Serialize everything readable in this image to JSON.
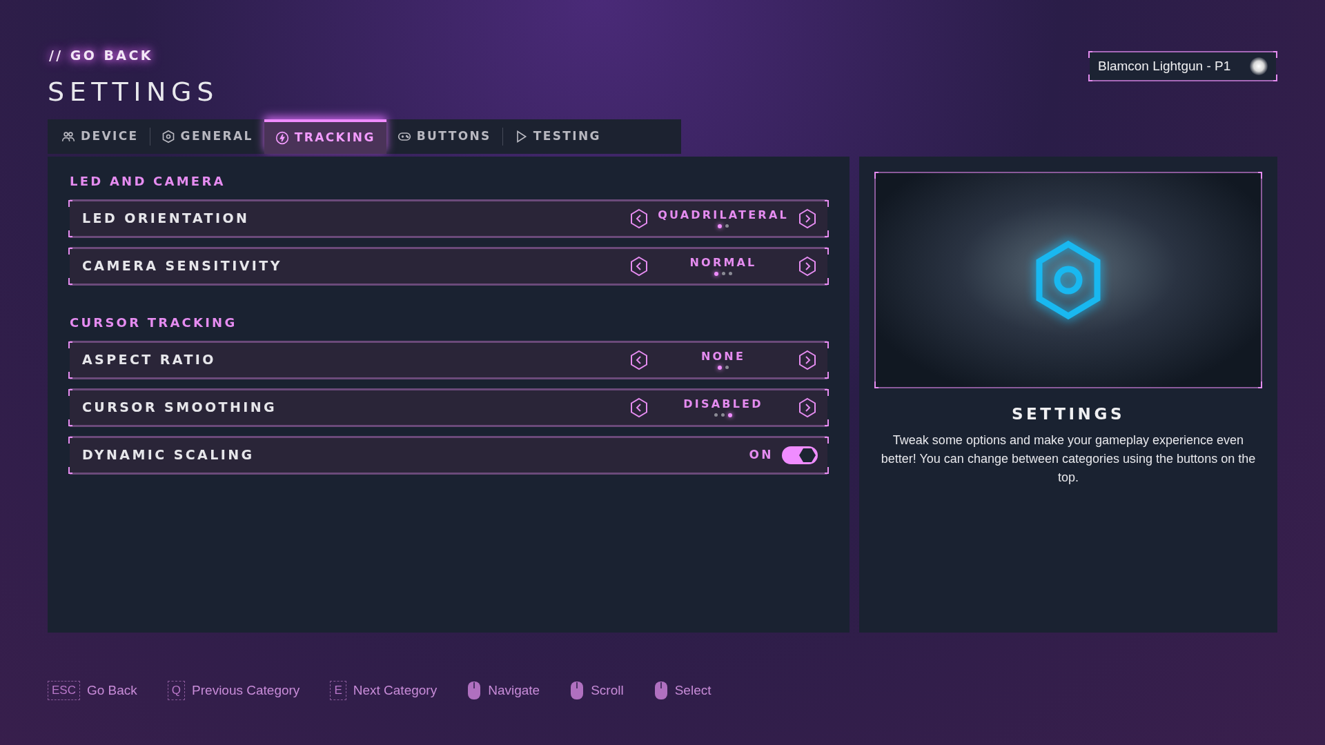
{
  "header": {
    "back_link": "// GO BACK",
    "title": "SETTINGS",
    "device": "Blamcon Lightgun - P1"
  },
  "tabs": [
    {
      "label": "DEVICE",
      "selected": false
    },
    {
      "label": "GENERAL",
      "selected": false
    },
    {
      "label": "TRACKING",
      "selected": true
    },
    {
      "label": "BUTTONS",
      "selected": false
    },
    {
      "label": "TESTING",
      "selected": false
    }
  ],
  "sections": [
    {
      "title": "LED AND CAMERA",
      "rows": [
        {
          "kind": "selector",
          "label": "LED ORIENTATION",
          "value": "QUADRILATERAL",
          "dots": [
            {
              "selected": true
            },
            {
              "selected": false
            }
          ]
        },
        {
          "kind": "selector",
          "label": "CAMERA SENSITIVITY",
          "value": "NORMAL",
          "dots": [
            {
              "selected": true
            },
            {
              "selected": false
            },
            {
              "selected": false
            }
          ]
        }
      ]
    },
    {
      "title": "CURSOR TRACKING",
      "rows": [
        {
          "kind": "selector",
          "label": "ASPECT RATIO",
          "value": "NONE",
          "dots": [
            {
              "selected": true
            },
            {
              "selected": false
            }
          ]
        },
        {
          "kind": "selector",
          "label": "CURSOR SMOOTHING",
          "value": "DISABLED",
          "dots": [
            {
              "selected": false
            },
            {
              "selected": false
            },
            {
              "selected": true
            }
          ]
        },
        {
          "kind": "toggle",
          "label": "DYNAMIC SCALING",
          "value": "ON",
          "on": true
        }
      ]
    }
  ],
  "info": {
    "title": "SETTINGS",
    "text": "Tweak some options and make your gameplay experience even better! You can change between categories using the buttons on the top."
  },
  "hints": [
    {
      "kind": "key",
      "key": "ESC",
      "label": "Go Back"
    },
    {
      "kind": "key",
      "key": "Q",
      "label": "Previous Category"
    },
    {
      "kind": "key",
      "key": "E",
      "label": "Next Category"
    },
    {
      "kind": "mouse",
      "label": "Navigate"
    },
    {
      "kind": "mouse",
      "label": "Scroll"
    },
    {
      "kind": "mouse",
      "label": "Select"
    }
  ]
}
